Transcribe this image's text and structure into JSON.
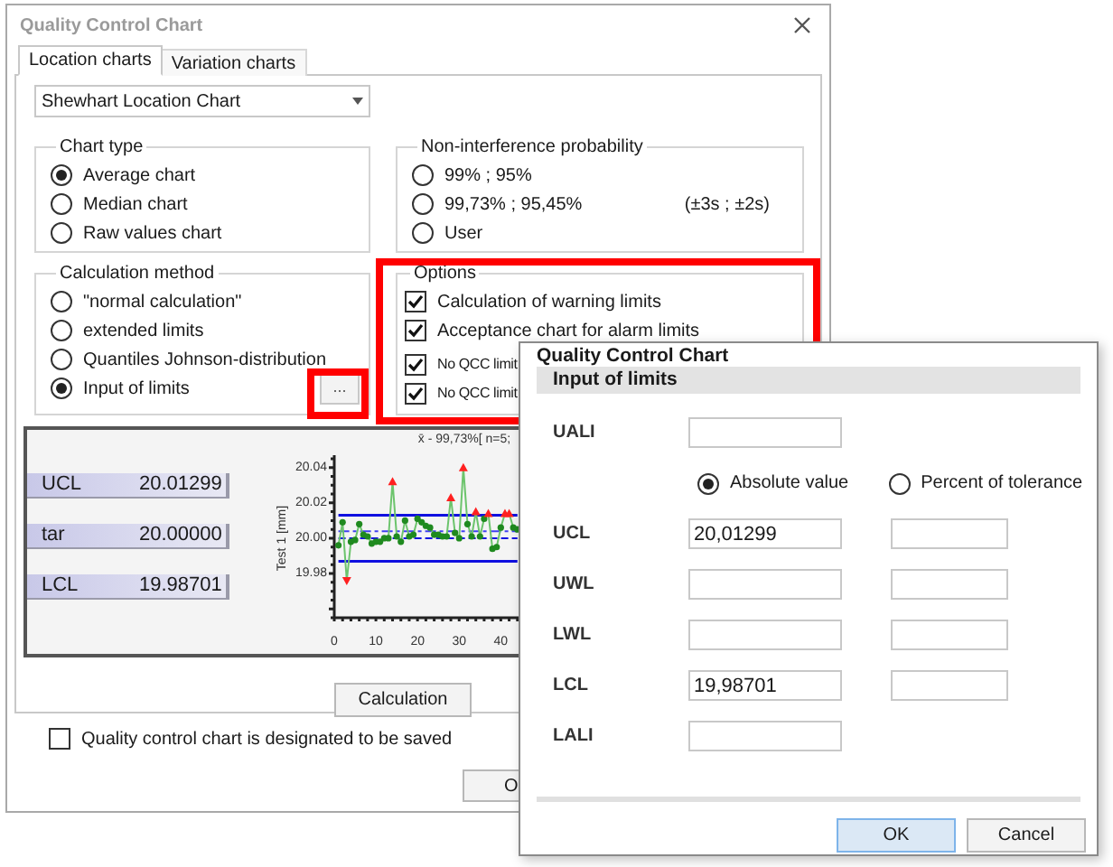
{
  "main_window": {
    "title": "Quality Control Chart",
    "tabs": [
      {
        "label": "Location charts",
        "selected": true
      },
      {
        "label": "Variation charts",
        "selected": false
      }
    ],
    "chart_selector": {
      "value": "Shewhart Location Chart"
    },
    "chart_type": {
      "title": "Chart type",
      "options": [
        {
          "label": "Average chart",
          "selected": true
        },
        {
          "label": "Median chart",
          "selected": false
        },
        {
          "label": "Raw values chart",
          "selected": false
        }
      ]
    },
    "non_interference_probability": {
      "title": "Non-interference probability",
      "options": [
        {
          "label": "99% ; 95%",
          "selected": false
        },
        {
          "label": "99,73% ; 95,45%",
          "note": "(±3s ; ±2s)",
          "selected": false
        },
        {
          "label": "User",
          "selected": false
        }
      ]
    },
    "calculation_method": {
      "title": "Calculation method",
      "options": [
        {
          "label": "\"normal calculation\"",
          "selected": false
        },
        {
          "label": "extended limits",
          "selected": false
        },
        {
          "label": "Quantiles Johnson-distribution",
          "selected": false
        },
        {
          "label": "Input of limits",
          "selected": true
        }
      ],
      "more_button": "...",
      "highlighted": true
    },
    "options": {
      "title": "Options",
      "highlighted": true,
      "items": [
        {
          "label": "Calculation of warning limits",
          "checked": true
        },
        {
          "label": "Acceptance chart for alarm limits",
          "checked": true
        },
        {
          "label": "No QCC limit",
          "checked": true
        },
        {
          "label": "No QCC limit",
          "checked": true
        }
      ]
    },
    "limits": [
      {
        "label": "UCL",
        "value": "20.01299"
      },
      {
        "label": "tar",
        "value": "20.00000"
      },
      {
        "label": "LCL",
        "value": "19.98701"
      }
    ],
    "chart_data": {
      "type": "line",
      "title": "x̄ -  99,73%[ n=5;",
      "ylabel": "Test 1 [mm]",
      "xticks": [
        0,
        10,
        20,
        30,
        40
      ],
      "yticks": [
        {
          "value": 19.98,
          "label": "19.98"
        },
        {
          "value": 20.0,
          "label": "20.00"
        },
        {
          "value": 20.02,
          "label": "20.02"
        },
        {
          "value": 20.04,
          "label": "20.04"
        }
      ],
      "xlim": [
        0,
        46
      ],
      "ylim": [
        19.955,
        20.047
      ],
      "x": [
        1,
        2,
        3,
        4,
        5,
        6,
        7,
        8,
        9,
        10,
        11,
        12,
        13,
        14,
        15,
        16,
        17,
        18,
        19,
        20,
        21,
        22,
        23,
        24,
        25,
        26,
        27,
        28,
        29,
        30,
        31,
        32,
        33,
        34,
        35,
        36,
        37,
        38,
        39,
        40,
        41,
        42,
        43,
        44
      ],
      "series": [
        {
          "color": "#6cc46c",
          "marker": "circle",
          "values": [
            19.996,
            20.009,
            19.976,
            19.998,
            19.999,
            20.008,
            20.002,
            20.001,
            19.997,
            19.998,
            19.998,
            20.0,
            20.0,
            20.032,
            20.001,
            19.998,
            20.01,
            20.001,
            20.002,
            20.011,
            20.009,
            20.007,
            20.006,
            20.002,
            20.002,
            20.001,
            20.001,
            20.023,
            20.003,
            20.0,
            20.04,
            20.008,
            20.001,
            20.015,
            20.001,
            20.011,
            20.014,
            19.994,
            19.995,
            20.006,
            20.014,
            20.014,
            20.006,
            20.005
          ]
        },
        {
          "color": "#1010e0",
          "values": [
            20.013,
            20.013,
            20.013,
            20.013,
            20.013,
            20.013,
            20.013,
            20.013,
            20.013,
            20.013,
            20.013,
            20.013,
            20.013,
            20.013,
            20.013,
            20.013,
            20.013,
            20.013,
            20.013,
            20.013,
            20.013,
            20.013,
            20.013,
            20.013,
            20.013,
            20.013,
            20.013,
            20.013,
            20.013,
            20.013,
            20.013,
            20.013,
            20.013,
            20.013,
            20.013,
            20.013,
            20.013,
            20.013,
            20.013,
            20.013,
            20.013,
            20.013,
            20.013,
            20.013
          ]
        },
        {
          "color": "#1010e0",
          "values": [
            19.987,
            19.987,
            19.987,
            19.987,
            19.987,
            19.987,
            19.987,
            19.987,
            19.987,
            19.987,
            19.987,
            19.987,
            19.987,
            19.987,
            19.987,
            19.987,
            19.987,
            19.987,
            19.987,
            19.987,
            19.987,
            19.987,
            19.987,
            19.987,
            19.987,
            19.987,
            19.987,
            19.987,
            19.987,
            19.987,
            19.987,
            19.987,
            19.987,
            19.987,
            19.987,
            19.987,
            19.987,
            19.987,
            19.987,
            19.987,
            19.987,
            19.987,
            19.987,
            19.987
          ]
        },
        {
          "color": "#1010e0",
          "line_style": "dashed",
          "values": [
            20.0,
            20.0,
            20.0,
            20.0,
            20.0,
            20.0,
            20.0,
            20.0,
            20.0,
            20.0,
            20.0,
            20.0,
            20.0,
            20.0,
            20.0,
            20.0,
            20.0,
            20.0,
            20.0,
            20.0,
            20.0,
            20.0,
            20.0,
            20.0,
            20.0,
            20.0,
            20.0,
            20.0,
            20.0,
            20.0,
            20.0,
            20.0,
            20.0,
            20.0,
            20.0,
            20.0,
            20.0,
            20.0,
            20.0,
            20.0,
            20.0,
            20.0,
            20.0,
            20.0
          ]
        },
        {
          "color": "#4040f0",
          "line_style": "dashdot",
          "values": [
            20.004,
            20.004,
            20.004,
            20.004,
            20.004,
            20.004,
            20.004,
            20.004,
            20.004,
            20.004,
            20.004,
            20.004,
            20.004,
            20.004,
            20.004,
            20.004,
            20.004,
            20.004,
            20.004,
            20.004,
            20.004,
            20.004,
            20.004,
            20.004,
            20.004,
            20.004,
            20.004,
            20.004,
            20.004,
            20.004,
            20.004,
            20.004,
            20.004,
            20.004,
            20.004,
            20.004,
            20.004,
            20.004,
            20.004,
            20.004,
            20.004,
            20.004,
            20.004,
            20.004
          ]
        }
      ]
    },
    "calculation_button": "Calculation",
    "save_checkbox": {
      "label": "Quality control chart is designated to be saved",
      "checked": false
    },
    "ok_button": "O"
  },
  "input_dialog": {
    "title": "Quality Control Chart",
    "header": "Input of limits",
    "rows": [
      {
        "kind": "single",
        "label": "UALI"
      },
      {
        "kind": "mode",
        "options": [
          {
            "label": "Absolute value",
            "selected": true
          },
          {
            "label": "Percent of tolerance",
            "selected": false
          }
        ]
      },
      {
        "kind": "pair",
        "label": "UCL",
        "absolute": "20,01299"
      },
      {
        "kind": "pair",
        "label": "UWL"
      },
      {
        "kind": "pair",
        "label": "LWL"
      },
      {
        "kind": "pair",
        "label": "LCL",
        "absolute": "19,98701"
      },
      {
        "kind": "single",
        "label": "LALI"
      }
    ],
    "buttons": [
      {
        "label": "OK",
        "default": true
      },
      {
        "label": "Cancel",
        "default": false
      }
    ]
  }
}
